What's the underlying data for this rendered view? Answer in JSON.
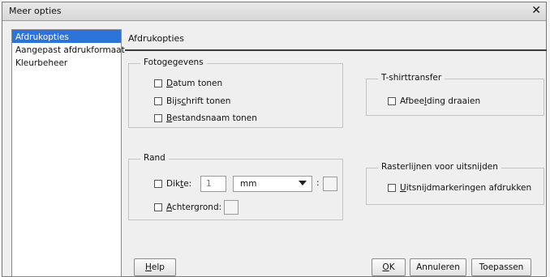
{
  "window": {
    "title": "Meer opties",
    "close_symbol": "✕"
  },
  "sidebar": {
    "items": [
      {
        "label": "Afdrukopties",
        "active": true
      },
      {
        "label": "Aangepast afdrukformaat",
        "active": false
      },
      {
        "label": "Kleurbeheer",
        "active": false
      }
    ]
  },
  "panel": {
    "title": "Afdrukopties"
  },
  "fotogegevens": {
    "legend": "Fotogegevens",
    "datum": {
      "u": "D",
      "rest": "atum tonen",
      "checked": false
    },
    "bijschrift": {
      "pre": "Bijs",
      "u": "c",
      "rest": "hrift tonen",
      "checked": false
    },
    "bestandsnaam": {
      "u": "B",
      "rest": "estandsnaam tonen",
      "checked": false
    }
  },
  "tshirt": {
    "legend": "T-shirttransfer",
    "afbeelding": {
      "pre": "Afbee",
      "u": "l",
      "rest": "ding draaien",
      "checked": false
    }
  },
  "rand": {
    "legend": "Rand",
    "dikte": {
      "pre": "Dik",
      "u": "t",
      "rest": "e:",
      "checked": false,
      "value": "1"
    },
    "unit": "mm",
    "colon": ":",
    "achtergrond": {
      "u": "A",
      "rest": "chtergrond:",
      "checked": false
    }
  },
  "rasterlijnen": {
    "legend": "Rasterlijnen voor uitsnijden",
    "uitsnijd": {
      "u": "U",
      "rest": "itsnijdmarkeringen afdrukken",
      "checked": false
    }
  },
  "buttons": {
    "help": {
      "u": "H",
      "rest": "elp"
    },
    "ok": {
      "u": "O",
      "rest": "K"
    },
    "annuleren": "Annuleren",
    "toepassen": "Toepassen"
  }
}
